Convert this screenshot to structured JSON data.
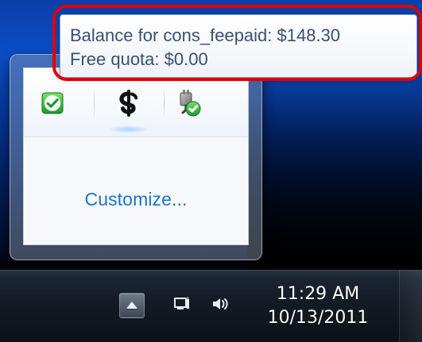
{
  "tooltip": {
    "line1": "Balance for cons_feepaid: $148.30",
    "line2": "Free quota: $0.00"
  },
  "flyout": {
    "customize_label": "Customize..."
  },
  "taskbar": {
    "time": "11:29 AM",
    "date": "10/13/2011"
  },
  "icons": {
    "security": "security-check-icon",
    "fee": "dollar-icon",
    "power": "power-plug-check-icon",
    "show_hidden": "chevron-up-icon",
    "network": "network-icon",
    "volume": "volume-icon"
  },
  "colors": {
    "highlight": "#e00000",
    "customize_link": "#1a73c9",
    "tooltip_text": "#3b4f72",
    "taskbar": "#121a23"
  }
}
